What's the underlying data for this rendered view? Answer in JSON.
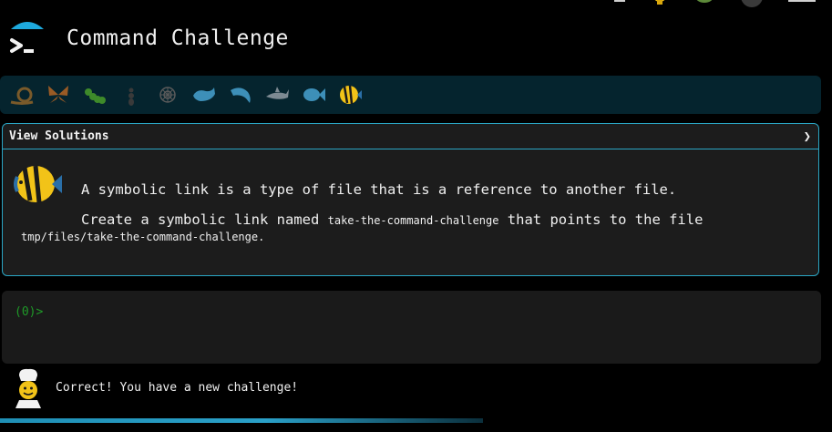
{
  "header": {
    "title": "Command Challenge"
  },
  "iconbar": {
    "icons": [
      "snail-icon",
      "butterfly-icon",
      "caterpillar-icon",
      "ant-icon",
      "spider-web-icon",
      "whale-icon",
      "dolphin-icon",
      "shark-icon",
      "fish-icon",
      "tropical-fish-icon"
    ]
  },
  "panel": {
    "header_label": "View Solutions",
    "line1": "A symbolic link is a type of file that is a reference to another file.",
    "line2_prefix": "Create a symbolic link named ",
    "link_name": "take-the-command-challenge",
    "line2_suffix": " that points to the file",
    "target_path": "tmp/files/take-the-command-challenge",
    "line3_suffix": "."
  },
  "terminal": {
    "prompt_open": "(",
    "prompt_count": "0",
    "prompt_close": ")>"
  },
  "message": {
    "text": "Correct! You have a new challenge!"
  },
  "progress": {
    "fraction": 0.58
  },
  "colors": {
    "accent": "#2aa6c4",
    "iconbar_bg": "#05242e",
    "prompt_green": "#35c93b"
  }
}
